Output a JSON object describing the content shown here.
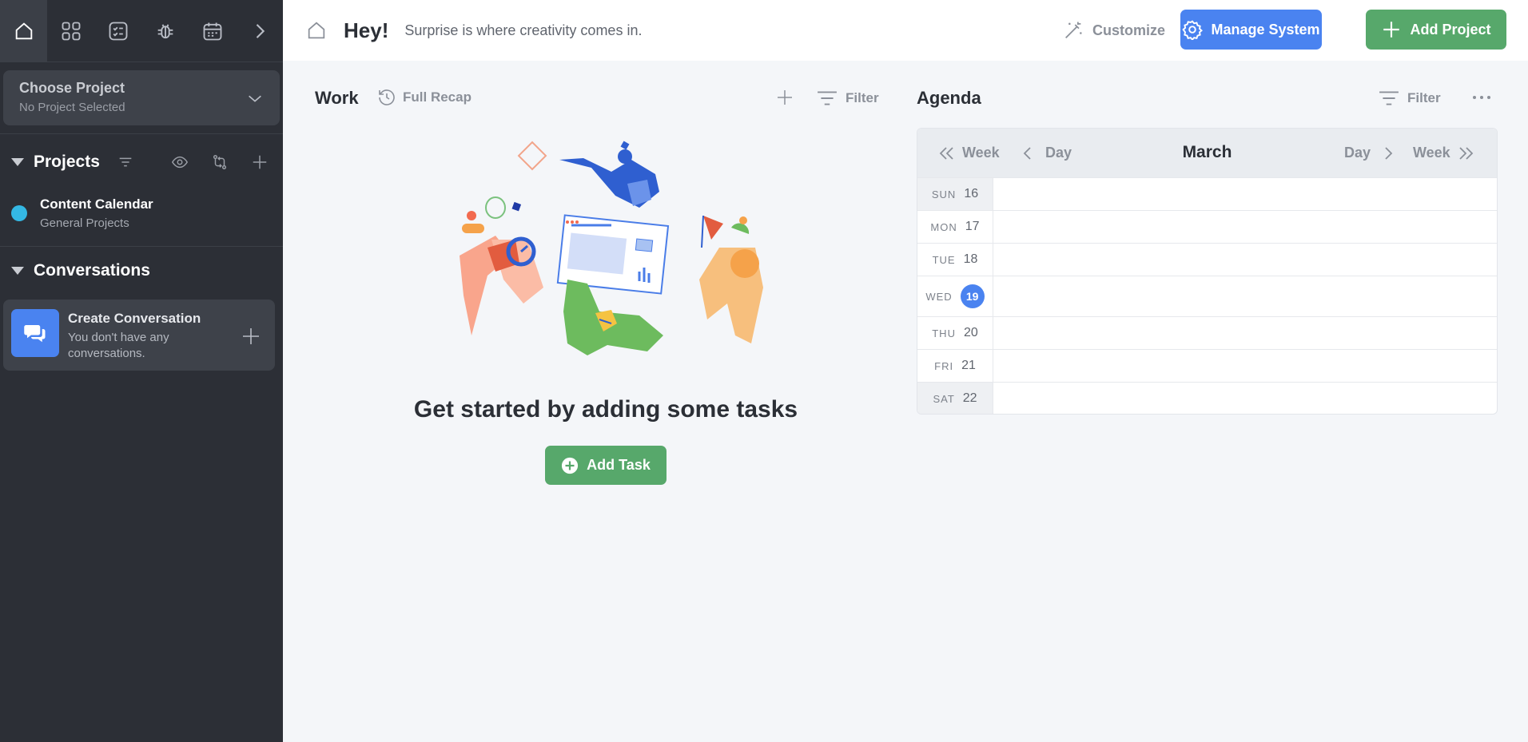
{
  "sidebar": {
    "top_icons": [
      "home-icon",
      "grid-icon",
      "checklist-icon",
      "bug-icon",
      "calendar-icon",
      "chevron-right-icon"
    ],
    "choose_project": {
      "title": "Choose Project",
      "subtitle": "No Project Selected"
    },
    "projects": {
      "title": "Projects",
      "items": [
        {
          "name": "Content Calendar",
          "subtitle": "General Projects",
          "color": "#34b8e4"
        }
      ]
    },
    "conversations": {
      "title": "Conversations",
      "create": {
        "title": "Create Conversation",
        "subtitle": "You don't have any conversations."
      }
    }
  },
  "header": {
    "greeting": "Hey!",
    "tagline": "Surprise is where creativity comes in.",
    "customize_label": "Customize",
    "manage_label": "Manage System",
    "add_project_label": "Add Project"
  },
  "work": {
    "title": "Work",
    "recap_label": "Full Recap",
    "filter_label": "Filter",
    "empty_title": "Get started by adding some tasks",
    "add_task_label": "Add Task"
  },
  "agenda": {
    "title": "Agenda",
    "filter_label": "Filter",
    "month": "March",
    "nav": {
      "prev_week": "Week",
      "prev_day": "Day",
      "next_day": "Day",
      "next_week": "Week"
    },
    "days": [
      {
        "dow": "SUN",
        "num": "16"
      },
      {
        "dow": "MON",
        "num": "17"
      },
      {
        "dow": "TUE",
        "num": "18"
      },
      {
        "dow": "WED",
        "num": "19"
      },
      {
        "dow": "THU",
        "num": "20"
      },
      {
        "dow": "FRI",
        "num": "21"
      },
      {
        "dow": "SAT",
        "num": "22"
      }
    ]
  },
  "colors": {
    "accent_blue": "#4a83f0",
    "accent_green": "#57a86b",
    "sidebar_bg": "#2c2f36"
  }
}
